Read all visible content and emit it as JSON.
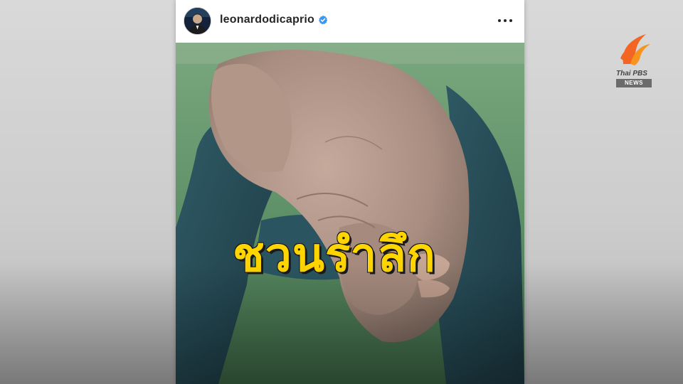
{
  "post": {
    "username": "leonardodicaprio",
    "verified_icon": "verified-badge-icon",
    "more_icon": "more-options-icon",
    "caption_overlay": "ชวนรำลึก"
  },
  "logo": {
    "name": "Thai PBS",
    "badge": "NEWS"
  },
  "colors": {
    "caption": "#ffd500",
    "verified": "#3897f0",
    "logo_orange": "#f26522"
  }
}
